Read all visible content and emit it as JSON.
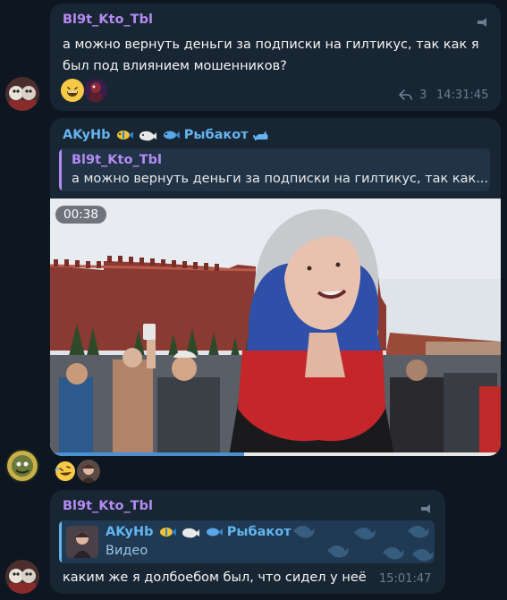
{
  "messages": [
    {
      "sender": "Bl9t_Kto_Tbl",
      "text": "а можно вернуть деньги за подписки на гилтикус, так как я был под влиянием мошенников?",
      "replies_count": "3",
      "time": "14:31:45"
    },
    {
      "sender": "AKyHb",
      "sender_tag": "Рыбакот",
      "quote_sender": "Bl9t_Kto_Tbl",
      "quote_text": "а можно вернуть деньги за подписки на гилтикус, так как...",
      "video_duration": "00:38",
      "video_progress": 0.43
    },
    {
      "sender": "Bl9t_Kto_Tbl",
      "quote_sender": "AKyHb",
      "quote_sender_tag": "Рыбакот",
      "quote_text": "Видео",
      "text": "каким же я долбоебом был, что сидел у неё",
      "time": "15:01:47"
    }
  ],
  "colors": {
    "background": "#0e1621",
    "bubble": "#182533",
    "sender_name": "#b48bf2",
    "accent": "#64b5ef"
  }
}
